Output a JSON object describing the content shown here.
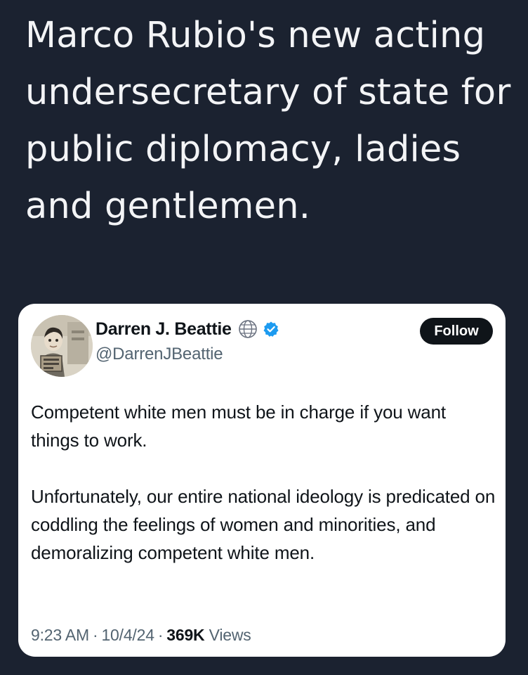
{
  "headline": "Marco Rubio's new acting undersecretary of state for public diplomacy, ladies and gentlemen.",
  "tweet": {
    "author": {
      "display_name": "Darren J. Beattie",
      "handle": "@DarrenJBeattie",
      "badges": [
        "globe-icon",
        "verified-icon"
      ]
    },
    "follow_label": "Follow",
    "paragraphs": [
      "Competent white men must be in charge if you want things to work.",
      "Unfortunately, our entire national ideology is predicated on coddling the feelings of women and minorities, and demoralizing competent white men."
    ],
    "meta": {
      "time": "9:23 AM",
      "separator": "·",
      "date": "10/4/24",
      "views_count": "369K",
      "views_label": "Views"
    }
  },
  "colors": {
    "background": "#1b2230",
    "card": "#ffffff",
    "verified": "#1d9bf0",
    "text_primary": "#0f1419",
    "text_secondary": "#536471"
  }
}
